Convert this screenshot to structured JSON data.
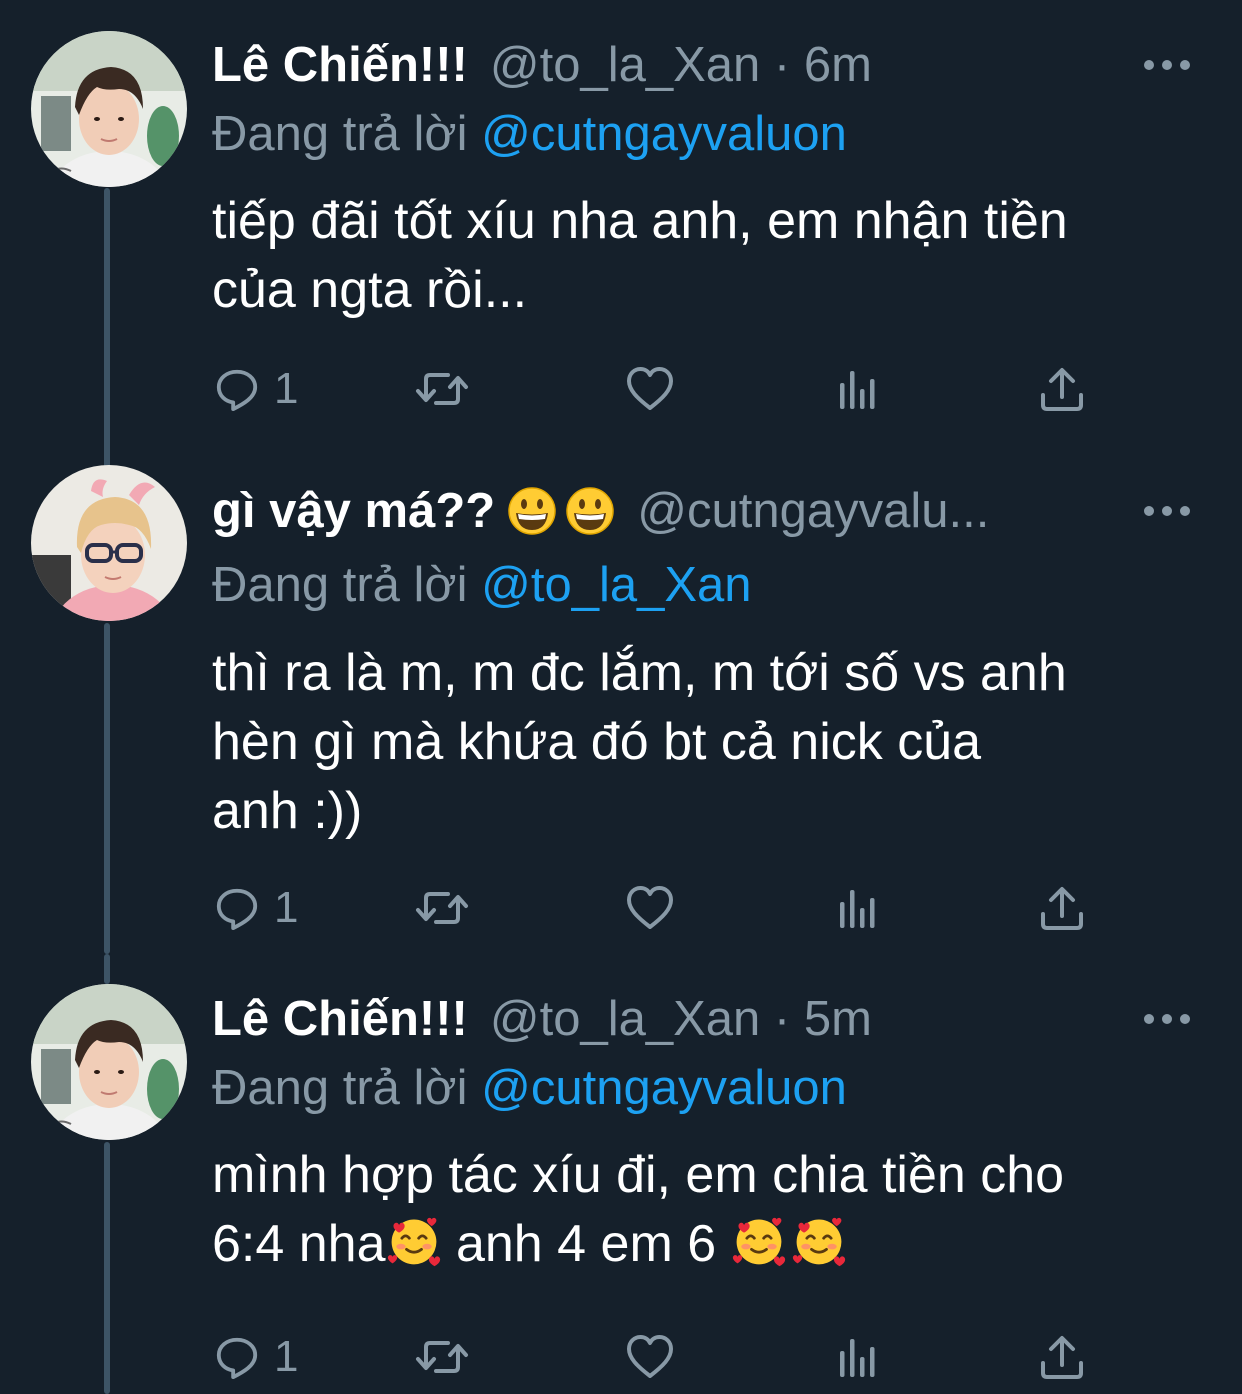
{
  "tweets": [
    {
      "display_name": "Lê Chiến!!!",
      "handle": "@to_la_Xan",
      "time": "6m",
      "reply_label": "Đang trả lời",
      "reply_to": "@cutngayvaluon",
      "text": "tiếp đãi tốt xíu nha anh, em nhận tiền\ncủa ngta rồi...",
      "reply_count": "1",
      "avatar_icon": "avatar-photo-boy-dark-hair"
    },
    {
      "display_name": "gì vậy má??",
      "name_emojis": [
        "grinning-face-emoji",
        "grinning-face-emoji"
      ],
      "handle": "@cutngayvalu...",
      "reply_label": "Đang trả lời",
      "reply_to": "@to_la_Xan",
      "text": "thì ra là m, m đc lắm, m tới số vs anh\nhèn gì mà khứa đó bt cả nick của\nanh :))",
      "reply_count": "1",
      "avatar_icon": "avatar-photo-blonde-glasses"
    },
    {
      "display_name": "Lê Chiến!!!",
      "handle": "@to_la_Xan",
      "time": "5m",
      "reply_label": "Đang trả lời",
      "reply_to": "@cutngayvaluon",
      "text_parts": [
        "mình hợp tác xíu đi, em chia tiền cho\n6:4 nha",
        " anh 4 em 6 "
      ],
      "text_emoji": "smiling-face-with-hearts-emoji",
      "reply_count": "1",
      "avatar_icon": "avatar-photo-boy-dark-hair"
    }
  ],
  "icons": {
    "reply": "reply-bubble-icon",
    "retweet": "retweet-icon",
    "like": "heart-icon",
    "analytics": "analytics-bars-icon",
    "share": "share-upload-icon",
    "more": "more-dots-icon"
  },
  "colors": {
    "background": "#15202b",
    "thread_line": "#3d5466",
    "secondary_text": "#8899a6",
    "link": "#1da1f2",
    "primary_text": "#ffffff"
  }
}
